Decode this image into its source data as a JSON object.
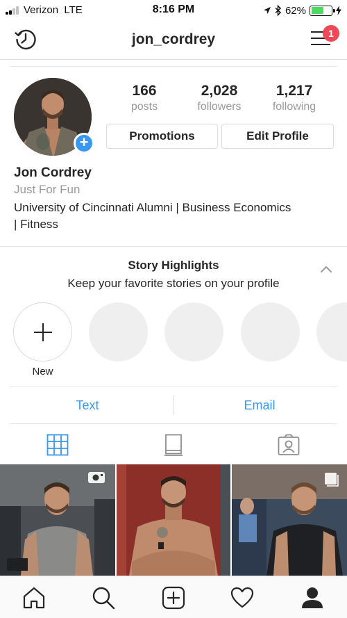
{
  "status_bar": {
    "carrier": "Verizon",
    "network": "LTE",
    "time": "8:16 PM",
    "battery_percent": "62%",
    "battery_level": 0.62,
    "battery_color": "#4cd964",
    "icons": [
      "signal-bars-icon",
      "location-arrow-icon",
      "bluetooth-icon",
      "battery-icon",
      "charging-bolt-icon"
    ]
  },
  "header": {
    "username": "jon_cordrey",
    "notification_count": "1",
    "icons": [
      "history-icon",
      "menu-icon"
    ]
  },
  "profile": {
    "stats": [
      {
        "value": "166",
        "label": "posts"
      },
      {
        "value": "2,028",
        "label": "followers"
      },
      {
        "value": "1,217",
        "label": "following"
      }
    ],
    "buttons": {
      "promotions": "Promotions",
      "edit_profile": "Edit Profile"
    },
    "full_name": "Jon Cordrey",
    "category": "Just For Fun",
    "bio_line1": "University of Cincinnati Alumni | Business Economics",
    "bio_line2": "| Fitness"
  },
  "highlights": {
    "title": "Story Highlights",
    "subtitle": "Keep your favorite stories on your profile",
    "new_label": "New"
  },
  "contact": {
    "text_label": "Text",
    "email_label": "Email"
  },
  "tabs": [
    "grid-icon",
    "igtv-icon",
    "tagged-icon"
  ],
  "grid": [
    {
      "type": "video",
      "badge_icon": "video-camera-icon"
    },
    {
      "type": "photo"
    },
    {
      "type": "multi",
      "badge_icon": "carousel-icon"
    }
  ],
  "bottom_nav": [
    "home-icon",
    "search-icon",
    "new-post-icon",
    "activity-heart-icon",
    "profile-icon"
  ],
  "colors": {
    "accent": "#3897f0",
    "badge_red": "#ed4956",
    "muted_text": "#999999",
    "border": "#dbdbdb"
  }
}
